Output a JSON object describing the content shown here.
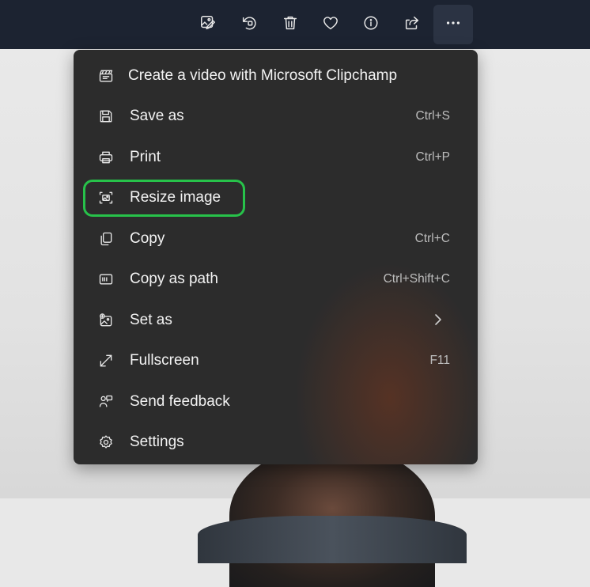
{
  "toolbar": {
    "buttons": [
      {
        "name": "edit-image-icon"
      },
      {
        "name": "rotate-icon"
      },
      {
        "name": "delete-icon"
      },
      {
        "name": "favorite-icon"
      },
      {
        "name": "info-icon"
      },
      {
        "name": "share-icon"
      },
      {
        "name": "more-options-icon"
      }
    ]
  },
  "menu": {
    "items": [
      {
        "label": "Create a video with Microsoft Clipchamp",
        "shortcut": "",
        "icon": "clipchamp-icon"
      },
      {
        "label": "Save as",
        "shortcut": "Ctrl+S",
        "icon": "save-icon"
      },
      {
        "label": "Print",
        "shortcut": "Ctrl+P",
        "icon": "print-icon"
      },
      {
        "label": "Resize image",
        "shortcut": "",
        "icon": "resize-image-icon"
      },
      {
        "label": "Copy",
        "shortcut": "Ctrl+C",
        "icon": "copy-icon"
      },
      {
        "label": "Copy as path",
        "shortcut": "Ctrl+Shift+C",
        "icon": "copy-path-icon"
      },
      {
        "label": "Set as",
        "shortcut": "",
        "icon": "set-as-icon",
        "submenu": true
      },
      {
        "label": "Fullscreen",
        "shortcut": "F11",
        "icon": "fullscreen-icon"
      },
      {
        "label": "Send feedback",
        "shortcut": "",
        "icon": "feedback-icon"
      },
      {
        "label": "Settings",
        "shortcut": "",
        "icon": "settings-icon"
      }
    ],
    "highlighted_item": "Resize image",
    "highlight_color": "#27c24a"
  },
  "colors": {
    "toolbar_bg": "#1c2331",
    "menu_bg": "#2c2c2c",
    "text": "#f3f3f3",
    "shortcut_text": "#bdbdbd"
  }
}
